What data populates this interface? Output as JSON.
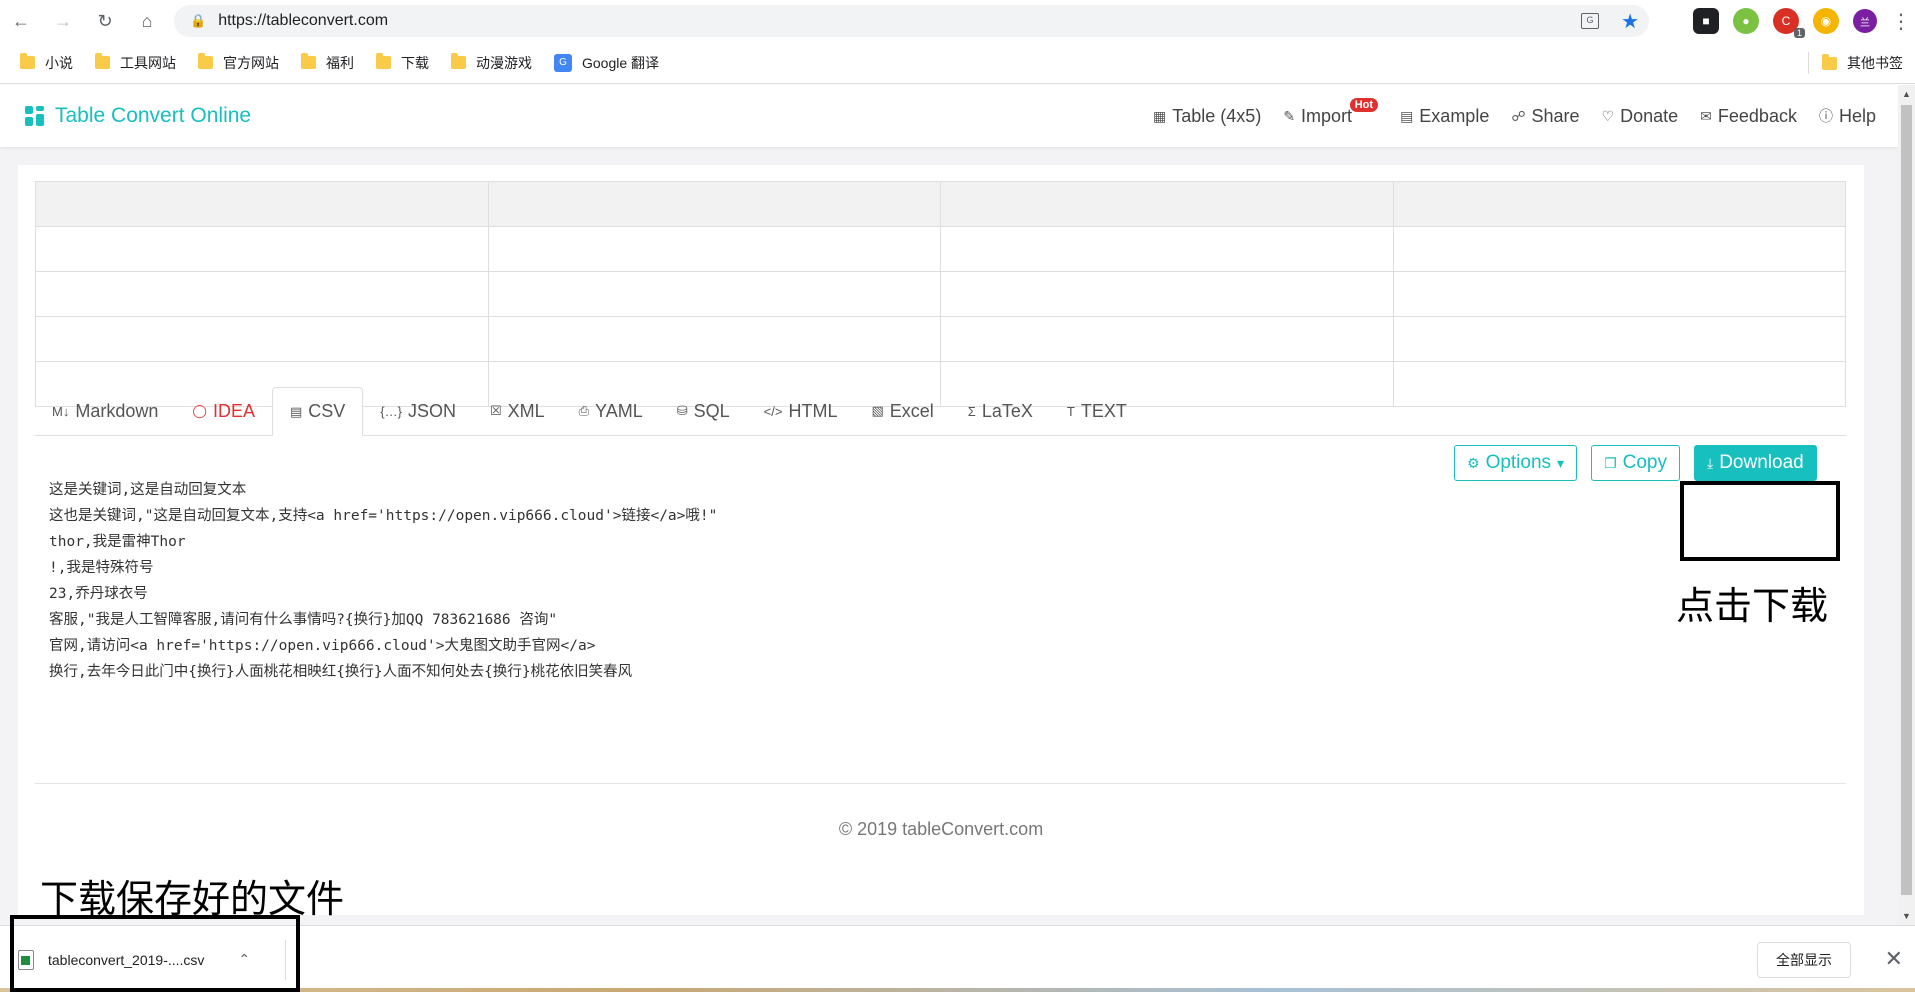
{
  "browser": {
    "url": "https://tableconvert.com",
    "translate_icon_text": "G",
    "badge_count": "1",
    "avatar_text": "兰"
  },
  "bookmarks": {
    "items": [
      "小说",
      "工具网站",
      "官方网站",
      "福利",
      "下载",
      "动漫游戏",
      "Google 翻译"
    ],
    "other": "其他书签"
  },
  "site": {
    "title": "Table Convert Online",
    "nav": {
      "table": "Table (4x5)",
      "import": "Import",
      "hot": "Hot",
      "example": "Example",
      "share": "Share",
      "donate": "Donate",
      "feedback": "Feedback",
      "help": "Help"
    },
    "tabs": [
      "Markdown",
      "IDEA",
      "CSV",
      "JSON",
      "XML",
      "YAML",
      "SQL",
      "HTML",
      "Excel",
      "LaTeX",
      "TEXT"
    ],
    "active_tab": "CSV",
    "output_lines": [
      "这是关键词,这是自动回复文本",
      "这也是关键词,\"这是自动回复文本,支持<a href='https://open.vip666.cloud'>链接</a>哦!\"",
      "thor,我是雷神Thor",
      "!,我是特殊符号",
      "23,乔丹球衣号",
      "客服,\"我是人工智障客服,请问有什么事情吗?{换行}加QQ 783621686 咨询\"",
      "官网,请访问<a href='https://open.vip666.cloud'>大鬼图文助手官网</a>",
      "换行,去年今日此门中{换行}人面桃花相映红{换行}人面不知何处去{换行}桃花依旧笑春风"
    ],
    "buttons": {
      "options": "Options",
      "copy": "Copy",
      "download": "Download"
    },
    "copyright": "© 2019 tableConvert.com"
  },
  "annotations": {
    "click_download": "点击下载",
    "saved_file": "下载保存好的文件"
  },
  "download_shelf": {
    "file_name": "tableconvert_2019-....csv",
    "show_all": "全部显示"
  },
  "colors": {
    "accent": "#17bfbf",
    "hot": "#e03131"
  }
}
